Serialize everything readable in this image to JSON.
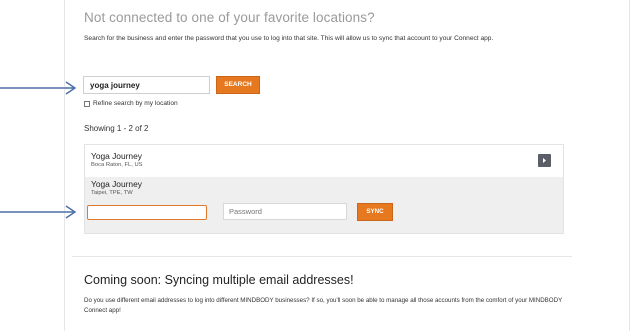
{
  "header": {
    "title": "Not connected to one of your favorite locations?",
    "description": "Search for the business and enter the password that you use to log into that site. This will allow us to sync that account to your Connect app."
  },
  "search": {
    "value": "yoga journey",
    "button_label": "SEARCH",
    "refine_label": "Refine search by my location"
  },
  "results": {
    "showing": "Showing 1 - 2 of 2",
    "items": [
      {
        "name": "Yoga Journey",
        "location": "Boca Raton, FL, US"
      },
      {
        "name": "Yoga Journey",
        "location": "Taipei, TPE, TW"
      }
    ]
  },
  "login": {
    "username_value": "",
    "password_placeholder": "Password",
    "sync_label": "SYNC"
  },
  "coming_soon": {
    "title": "Coming soon: Syncing multiple email addresses!",
    "description": "Do you use different email addresses to log into different MINDBODY businesses? If so, you'll soon be able to manage all those accounts from the comfort of your MINDBODY Connect app!"
  },
  "annotations": {
    "arrow_color": "#4a6fa5"
  },
  "colors": {
    "accent": "#e6791f",
    "heading_gray": "#9a9a9a"
  }
}
